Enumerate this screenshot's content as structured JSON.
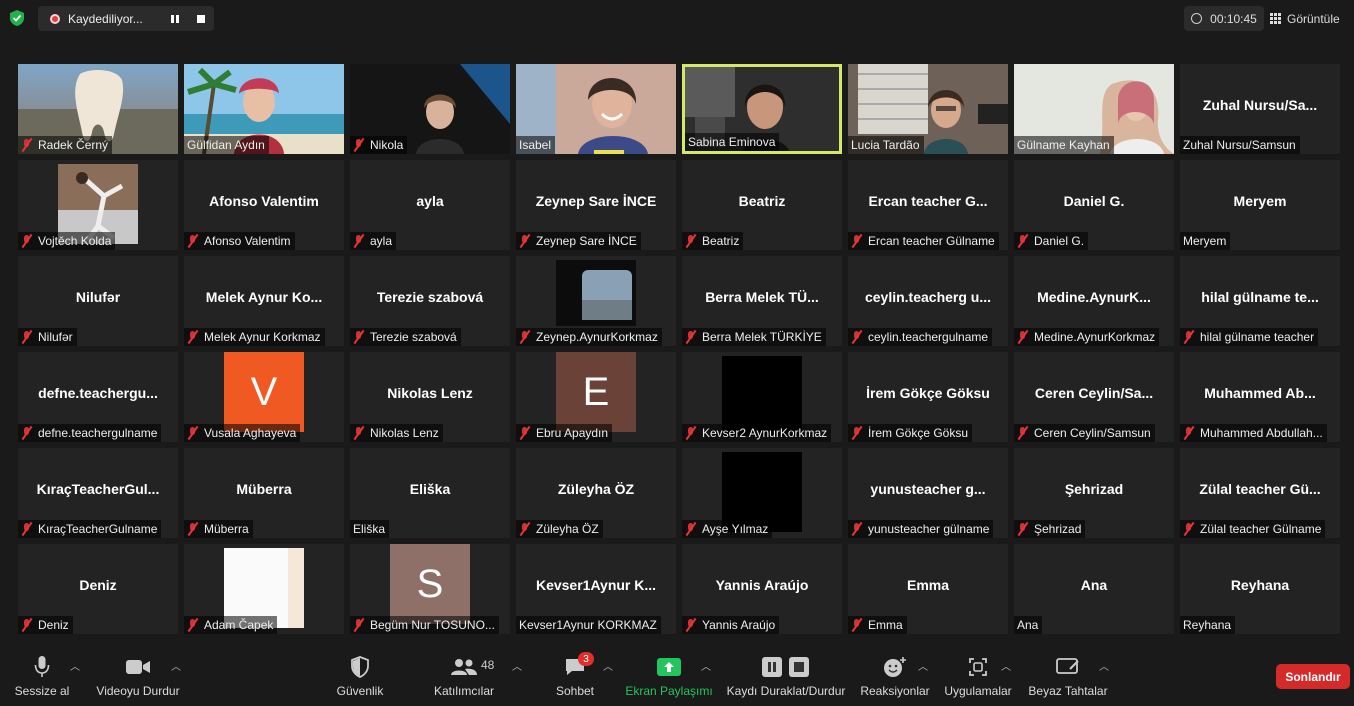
{
  "topbar": {
    "recording_label": "Kaydediliyor...",
    "timer": "00:10:45",
    "view_label": "Görüntüle"
  },
  "participants": [
    {
      "name": "",
      "label": "Radek Černý",
      "muted": true,
      "video": "tooth"
    },
    {
      "name": "",
      "label": "Gülfidan Aydın",
      "muted": false,
      "video": "beach"
    },
    {
      "name": "",
      "label": "Nikola",
      "muted": true,
      "video": "dark-room"
    },
    {
      "name": "",
      "label": "Isabel",
      "muted": false,
      "video": "smile"
    },
    {
      "name": "",
      "label": "Sabina Eminova",
      "muted": false,
      "video": "office",
      "active": true
    },
    {
      "name": "",
      "label": "Lucia Tardão",
      "muted": false,
      "video": "window"
    },
    {
      "name": "",
      "label": "Gülname Kayhan",
      "muted": false,
      "video": "hijab"
    },
    {
      "name": "Zuhal  Nursu/Sa...",
      "label": "Zuhal Nursu/Samsun",
      "muted": false
    },
    {
      "name": "",
      "label": "Vojtěch Kolda",
      "muted": true,
      "video": "photo"
    },
    {
      "name": "Afonso Valentim",
      "label": "Afonso Valentim",
      "muted": true
    },
    {
      "name": "ayla",
      "label": "ayla",
      "muted": true
    },
    {
      "name": "Zeynep Sare İNCE",
      "label": "Zeynep Sare İNCE",
      "muted": true
    },
    {
      "name": "Beatriz",
      "label": "Beatriz",
      "muted": true
    },
    {
      "name": "Ercan teacher  G...",
      "label": "Ercan teacher Gülname",
      "muted": true
    },
    {
      "name": "Daniel G.",
      "label": "Daniel G.",
      "muted": true
    },
    {
      "name": "Meryem",
      "label": "Meryem",
      "muted": false
    },
    {
      "name": "Nilufər",
      "label": "Nilufər",
      "muted": true
    },
    {
      "name": "Melek Aynur  Ko...",
      "label": "Melek Aynur Korkmaz",
      "muted": true
    },
    {
      "name": "Terezie szabová",
      "label": "Terezie szabová",
      "muted": true
    },
    {
      "name": "",
      "label": "Zeynep.AynurKorkmaz",
      "muted": true,
      "video": "window-small"
    },
    {
      "name": "Berra Melek  TÜ...",
      "label": "Berra Melek TÜRKİYE",
      "muted": true
    },
    {
      "name": "ceylin.teacherg u...",
      "label": "ceylin.teachergulname",
      "muted": true
    },
    {
      "name": "Medine.AynurK...",
      "label": "Medine.AynurKorkmaz",
      "muted": true
    },
    {
      "name": "hilal gülname  te...",
      "label": "hilal gülname teacher",
      "muted": true
    },
    {
      "name": "defne.teachergu...",
      "label": "defne.teachergulname",
      "muted": true
    },
    {
      "name": "",
      "label": "Vusala Aghayeva",
      "muted": true,
      "avatar": "V",
      "avatar_color": "#f05a22"
    },
    {
      "name": "Nikolas Lenz",
      "label": "Nikolas Lenz",
      "muted": true
    },
    {
      "name": "",
      "label": "Ebru Apaydın",
      "muted": true,
      "avatar": "E",
      "avatar_color": "#6b4237"
    },
    {
      "name": "",
      "label": "Kevser2 AynurKorkmaz",
      "muted": true,
      "video": "black"
    },
    {
      "name": "İrem Gökçe Göksu",
      "label": "İrem Gökçe Göksu",
      "muted": true
    },
    {
      "name": "Ceren  Ceylin/Sa...",
      "label": "Ceren Ceylin/Samsun",
      "muted": true
    },
    {
      "name": "Muhammed  Ab...",
      "label": "Muhammed Abdullah...",
      "muted": true
    },
    {
      "name": "KıraçTeacherGul...",
      "label": "KıraçTeacherGulname",
      "muted": true
    },
    {
      "name": "Müberra",
      "label": "Müberra",
      "muted": true
    },
    {
      "name": "Eliška",
      "label": "Eliška",
      "muted": false
    },
    {
      "name": "Züleyha ÖZ",
      "label": "Züleyha ÖZ",
      "muted": true
    },
    {
      "name": "",
      "label": "Ayşe Yılmaz",
      "muted": true,
      "video": "black"
    },
    {
      "name": "yunusteacher  g...",
      "label": "yunusteacher gülname",
      "muted": true
    },
    {
      "name": "Şehrizad",
      "label": "Şehrizad",
      "muted": true
    },
    {
      "name": "Zülal teacher  Gü...",
      "label": "Zülal teacher Gülname",
      "muted": true
    },
    {
      "name": "Deniz",
      "label": "Deniz",
      "muted": true
    },
    {
      "name": "",
      "label": "Adam Čapek",
      "muted": true,
      "video": "white"
    },
    {
      "name": "",
      "label": "Begüm Nur TOSUNO...",
      "muted": true,
      "avatar": "S",
      "avatar_color": "#8f7068"
    },
    {
      "name": "Kevser1Aynur  K...",
      "label": "Kevser1Aynur KORKMAZ",
      "muted": false
    },
    {
      "name": "Yannis Araújo",
      "label": "Yannis Araújo",
      "muted": true
    },
    {
      "name": "Emma",
      "label": "Emma",
      "muted": true
    },
    {
      "name": "Ana",
      "label": "Ana",
      "muted": false
    },
    {
      "name": "Reyhana",
      "label": "Reyhana",
      "muted": false
    }
  ],
  "toolbar": {
    "mute_label": "Sessize al",
    "video_label": "Videoyu Durdur",
    "security_label": "Güvenlik",
    "participants_label": "Katılımcılar",
    "participants_count": "48",
    "chat_label": "Sohbet",
    "chat_badge": "3",
    "share_label": "Ekran Paylaşımı",
    "record_label": "Kaydı Duraklat/Durdur",
    "reactions_label": "Reaksiyonlar",
    "apps_label": "Uygulamalar",
    "whiteboard_label": "Beyaz Tahtalar",
    "end_label": "Sonlandır"
  },
  "colors": {
    "background": "#1a1a1a",
    "tile": "#232323",
    "active_border": "#d6e86a",
    "end_button": "#d42a2a",
    "share_green": "#22c55e"
  }
}
